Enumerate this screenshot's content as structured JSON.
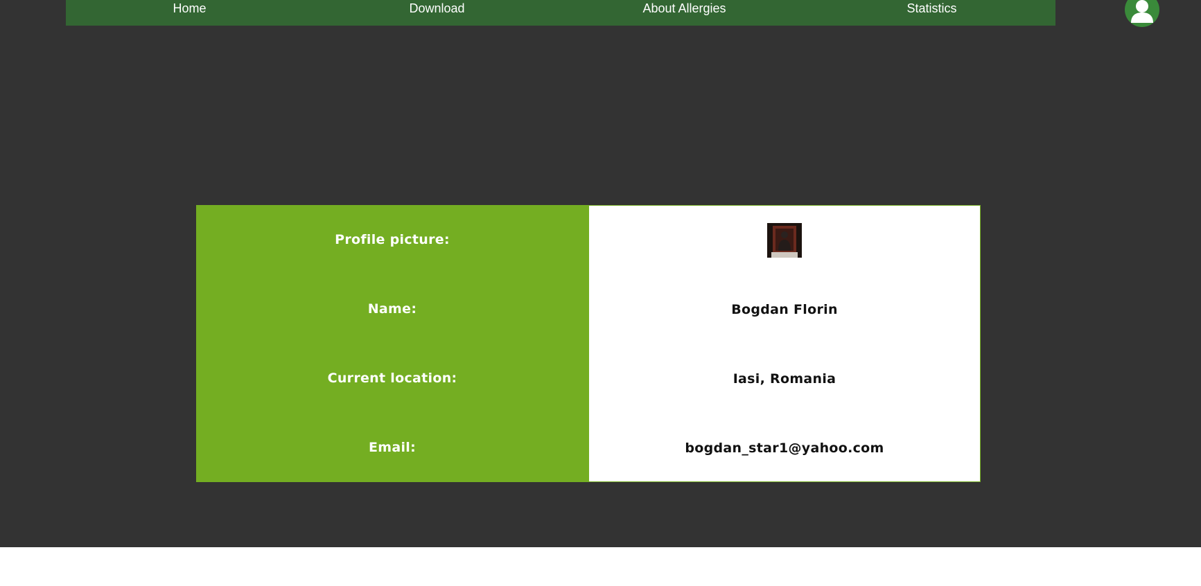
{
  "nav": {
    "items": [
      {
        "label": "Home"
      },
      {
        "label": "Download"
      },
      {
        "label": "About Allergies"
      },
      {
        "label": "Statistics"
      }
    ],
    "user_icon": "user-icon",
    "bar_color": "#336633"
  },
  "profile": {
    "rows": [
      {
        "label": "Profile picture:",
        "value": ""
      },
      {
        "label": "Name:",
        "value": "Bogdan Florin"
      },
      {
        "label": "Current location:",
        "value": "Iasi, Romania"
      },
      {
        "label": "Email:",
        "value": "bogdan_star1@yahoo.com"
      }
    ],
    "label_bg": "#74ae22",
    "value_bg": "#ffffff"
  },
  "theme": {
    "page_bg": "#333333",
    "footer_bg": "#ffffff"
  }
}
